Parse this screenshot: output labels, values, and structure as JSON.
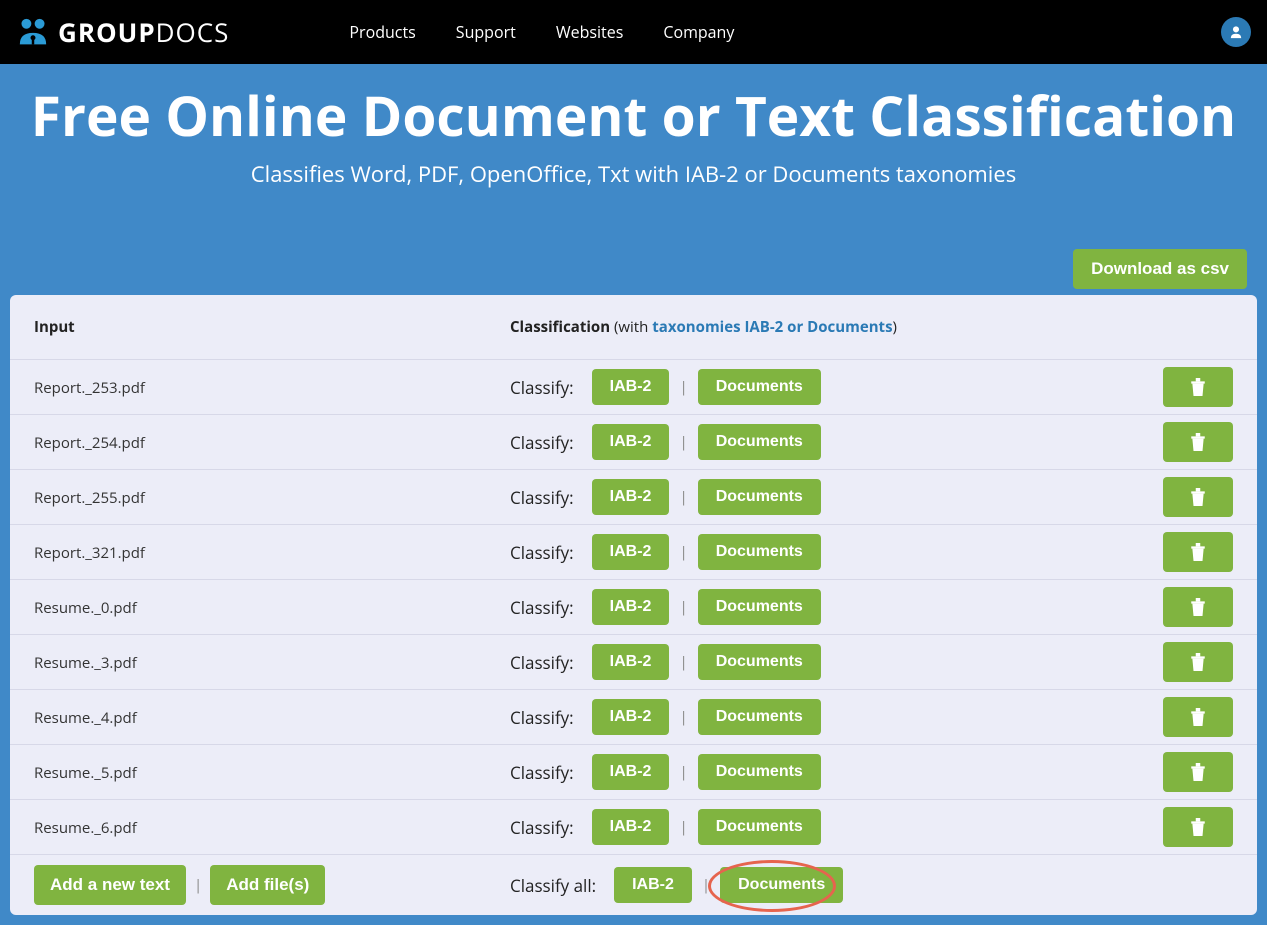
{
  "nav": {
    "brand1": "GROUP",
    "brand2": "DOCS",
    "links": [
      "Products",
      "Support",
      "Websites",
      "Company"
    ]
  },
  "hero": {
    "title": "Free Online Document or Text Classification",
    "subtitle": "Classifies Word, PDF, OpenOffice, Txt with IAB-2 or Documents taxonomies"
  },
  "download_csv": "Download as csv",
  "headers": {
    "input": "Input",
    "classification": "Classification",
    "with_open": " (with ",
    "tax_link": "taxonomies IAB-2 or Documents",
    "with_close": ")"
  },
  "row_labels": {
    "classify": "Classify:",
    "iab2": "IAB-2",
    "documents": "Documents",
    "sep": "|"
  },
  "files": [
    "Report._253.pdf",
    "Report._254.pdf",
    "Report._255.pdf",
    "Report._321.pdf",
    "Resume._0.pdf",
    "Resume._3.pdf",
    "Resume._4.pdf",
    "Resume._5.pdf",
    "Resume._6.pdf"
  ],
  "footer": {
    "add_text": "Add a new text",
    "add_files": "Add file(s)",
    "classify_all": "Classify all:",
    "sep": "|"
  }
}
